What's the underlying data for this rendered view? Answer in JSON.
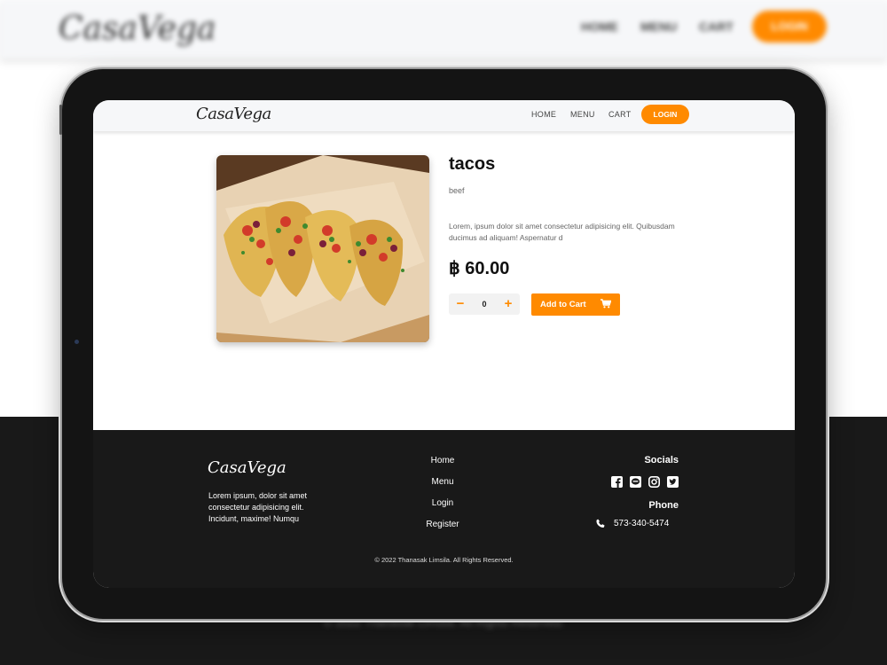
{
  "brand": {
    "name": "CasaVega",
    "accent": "#ff8a00",
    "dark": "#191919"
  },
  "background": {
    "logo": "CasaVega",
    "nav": {
      "home": "HOME",
      "menu": "MENU",
      "cart": "CART",
      "login": "LOGIN"
    },
    "copyright": "© 2022 Thanasak Limsila. All Rights Reserved."
  },
  "nav": {
    "logo": "CasaVega",
    "home": "HOME",
    "menu": "MENU",
    "cart": "CART",
    "login": "LOGIN"
  },
  "product": {
    "name": "tacos",
    "category": "beef",
    "description": "Lorem, ipsum dolor sit amet consectetur adipisicing elit. Quibusdam ducimus ad aliquam! Aspernatur d",
    "price": "฿ 60.00",
    "quantity": "0",
    "qty_minus": "−",
    "qty_plus": "+",
    "add_to_cart": "Add to Cart",
    "image_icon": "tacos-photo"
  },
  "footer": {
    "logo": "CasaVega",
    "tagline": "Lorem ipsum, dolor sit amet consectetur adipisicing elit. Incidunt, maxime! Numqu",
    "links": [
      "Home",
      "Menu",
      "Login",
      "Register"
    ],
    "socials_heading": "Socials",
    "social_icons": [
      "facebook-icon",
      "line-icon",
      "instagram-icon",
      "twitter-icon"
    ],
    "phone_heading": "Phone",
    "phone": "573-340-5474",
    "copyright": "© 2022 Thanasak Limsila. All Rights Reserved."
  }
}
